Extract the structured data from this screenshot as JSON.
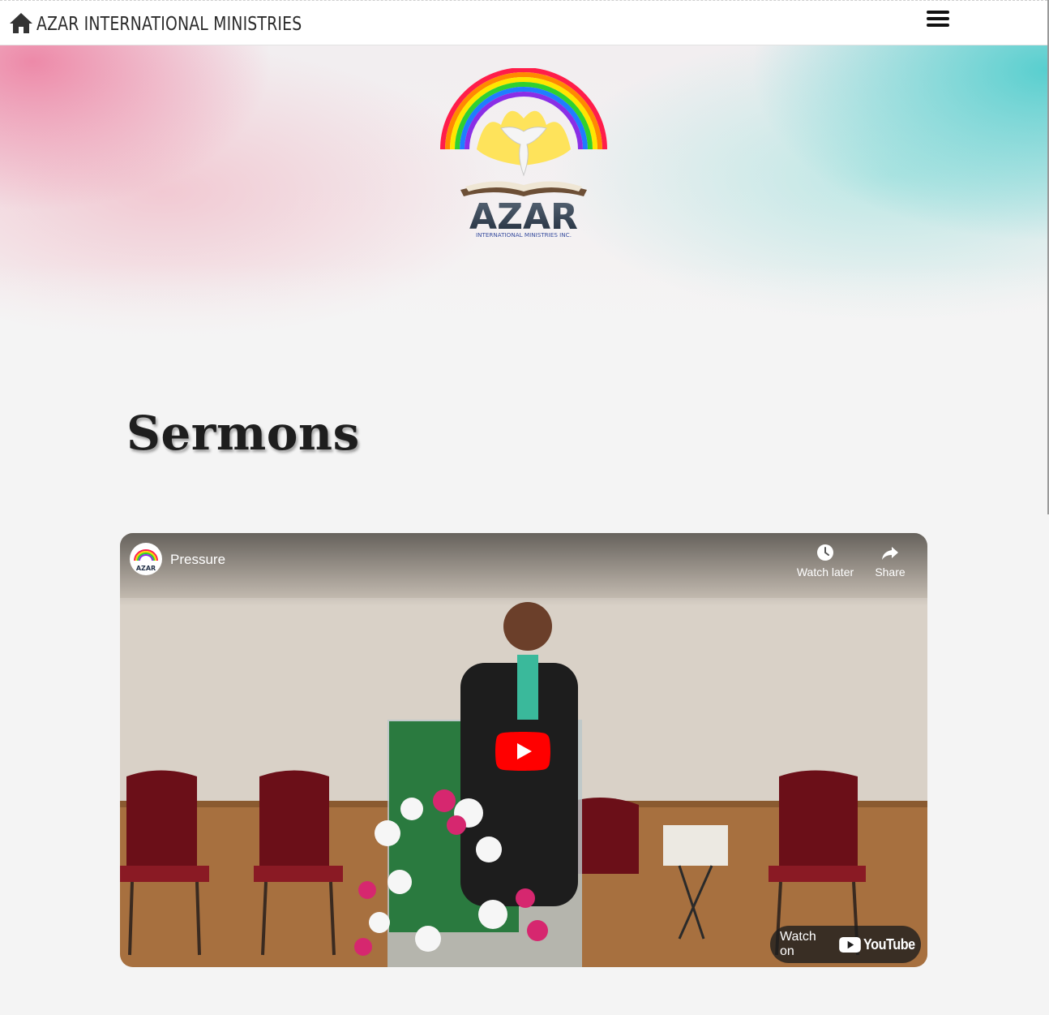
{
  "header": {
    "site_title": "AZAR INTERNATIONAL MINISTRIES",
    "home_icon": "home-icon",
    "menu_icon": "hamburger-menu-icon"
  },
  "hero": {
    "logo_text": "AZAR",
    "logo_subtext": "INTERNATIONAL MINISTRIES INC."
  },
  "main": {
    "heading": "Sermons"
  },
  "video": {
    "title": "Pressure",
    "channel_avatar_text": "AZAR",
    "actions": [
      {
        "label": "Watch later",
        "icon": "clock-icon"
      },
      {
        "label": "Share",
        "icon": "share-arrow-icon"
      }
    ],
    "watch_on_label": "Watch on",
    "youtube_label": "YouTube",
    "play_icon": "play-icon"
  },
  "colors": {
    "youtube_red": "#ff0000",
    "text_dark": "#1e1e1e",
    "hero_pink": "#ec789c",
    "hero_teal": "#50cdcd"
  }
}
